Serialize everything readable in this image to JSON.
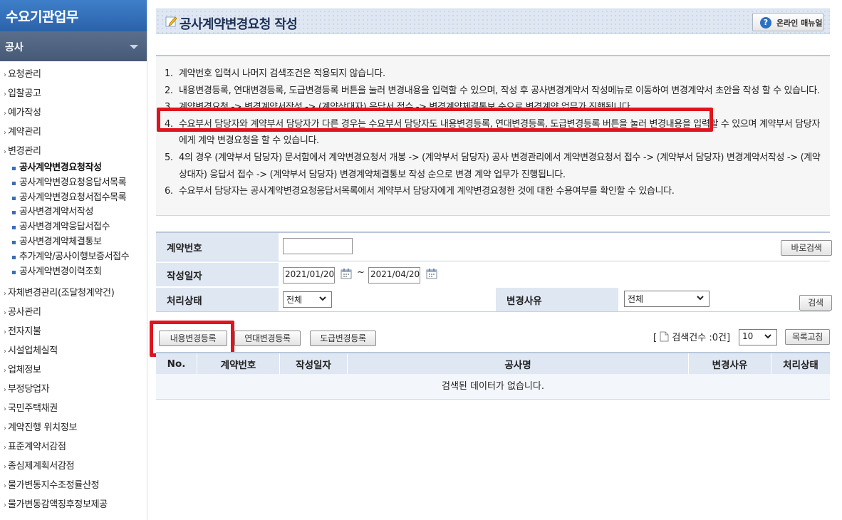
{
  "sidebar": {
    "title": "수요기관업무",
    "category": "공사",
    "items": [
      {
        "label": "요청관리"
      },
      {
        "label": "입찰공고"
      },
      {
        "label": "예가작성"
      },
      {
        "label": "계약관리"
      },
      {
        "label": "변경관리"
      }
    ],
    "sub_items": [
      {
        "label": "공사계약변경요청작성",
        "active": true
      },
      {
        "label": "공사계약변경요청응답서목록"
      },
      {
        "label": "공사계약변경요청서접수목록"
      },
      {
        "label": "공사변경계약서작성"
      },
      {
        "label": "공사변경계약응답서접수"
      },
      {
        "label": "공사변경계약체결통보"
      },
      {
        "label": "추가계약/공사이행보증서접수"
      },
      {
        "label": "공사계약변경이력조회"
      }
    ],
    "items_after": [
      {
        "label": "자체변경관리(조달청계약건)"
      },
      {
        "label": "공사관리"
      },
      {
        "label": "전자지불"
      },
      {
        "label": "시설업체실적"
      },
      {
        "label": "업체정보"
      },
      {
        "label": "부정당업자"
      },
      {
        "label": "국민주택채권"
      },
      {
        "label": "계약진행 위치정보"
      },
      {
        "label": "표준계약서감점"
      },
      {
        "label": "종심제계획서감점"
      },
      {
        "label": "물가변동지수조정률산정"
      },
      {
        "label": "물가변동감액징후정보제공"
      }
    ]
  },
  "header": {
    "title": "공사계약변경요청 작성",
    "manual_label": "온라인 매뉴얼"
  },
  "notes": [
    {
      "num": "1.",
      "text": "계약번호 입력시 나머지 검색조건은 적용되지 않습니다."
    },
    {
      "num": "2.",
      "text": "내용변경등록, 연대변경등록, 도급변경등록 버튼을 눌러 변경내용을 입력할 수 있으며, 작성 후 공사변경계약서 작성메뉴로 이동하여 변경계약서 초안을 작성 할 수 있습니다."
    },
    {
      "num": "3.",
      "text": "계약변경요청 -> 변경계약서작성 -> (계약상대자) 응답서 접수 -> 변경계약체결통보 순으로 변경계약 업무가 진행됩니다."
    },
    {
      "num": "4.",
      "text": "수요부서 담당자와 계약부서 담당자가 다른 경우는 수요부서 담당자도 내용변경등록, 연대변경등록, 도급변경등록 버튼을 눌러 변경내용을 입력할 수 있으며 계약부서 담당자에게 계약 변경요청을 할 수 있습니다."
    },
    {
      "num": "5.",
      "text": "4의 경우 (계약부서 담당자) 문서함에서 계약변경요청서 개봉 -> (계약부서 담당자) 공사 변경관리에서 계약변경요청서 접수 -> (계약부서 담당자) 변경계약서작성 -> (계약상대자) 응답서 접수 -> (계약부서 담당자) 변경계약체결통보 작성 순으로 변경 계약 업무가 진행됩니다."
    },
    {
      "num": "6.",
      "text": "수요부서 담당자는 공사계약변경요청응답서목록에서 계약부서 담당자에게 계약변경요청한 것에 대한 수용여부를 확인할 수 있습니다."
    }
  ],
  "form": {
    "contract_no_label": "계약번호",
    "contract_no_value": "",
    "quick_search_label": "바로검색",
    "date_label": "작성일자",
    "date_from": "2021/01/20",
    "date_to": "2021/04/20",
    "date_sep": "~",
    "status_label": "처리상태",
    "status_value": "전체",
    "reason_label": "변경사유",
    "reason_value": "전체",
    "search_label": "검색"
  },
  "actions": {
    "content_change": "내용변경등록",
    "joint_change": "연대변경등록",
    "subcontract_change": "도급변경등록",
    "count_prefix": "[",
    "count_text": "검색건수 :0건]",
    "page_size": "10",
    "refresh": "목록고침"
  },
  "table": {
    "headers": [
      "No.",
      "계약번호",
      "작성일자",
      "공사명",
      "변경사유",
      "처리상태"
    ],
    "empty_message": "검색된 데이터가 없습니다."
  },
  "colors": {
    "highlight": "#e0141e",
    "accent": "#2a62ab"
  }
}
